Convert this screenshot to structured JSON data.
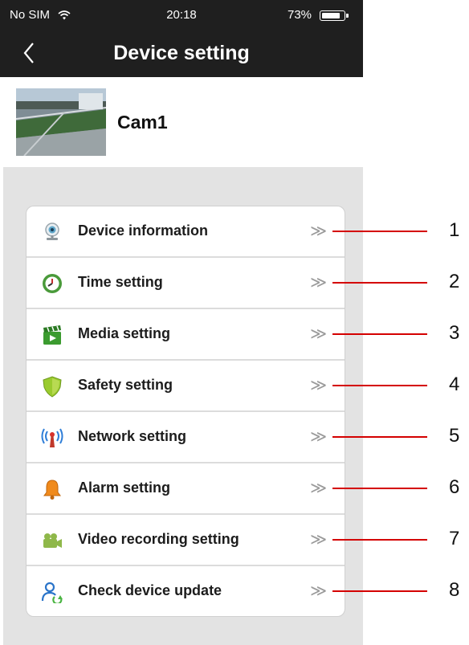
{
  "status_bar": {
    "carrier": "No SIM",
    "time": "20:18",
    "battery": "73%",
    "battery_level": 0.73,
    "wifi_icon": "wifi-icon"
  },
  "nav": {
    "title": "Device setting",
    "back_icon": "chevron-left-icon"
  },
  "device": {
    "name": "Cam1",
    "thumbnail": "camera-snapshot"
  },
  "menu": {
    "arrow": "≫",
    "items": [
      {
        "label": "Device information",
        "icon": "webcam-icon",
        "callout": "1"
      },
      {
        "label": "Time setting",
        "icon": "clock-icon",
        "callout": "2"
      },
      {
        "label": "Media setting",
        "icon": "clapperboard-icon",
        "callout": "3"
      },
      {
        "label": "Safety setting",
        "icon": "shield-icon",
        "callout": "4"
      },
      {
        "label": "Network setting",
        "icon": "antenna-icon",
        "callout": "5"
      },
      {
        "label": "Alarm setting",
        "icon": "bell-icon",
        "callout": "6"
      },
      {
        "label": "Video recording setting",
        "icon": "video-camera-icon",
        "callout": "7"
      },
      {
        "label": "Check device update",
        "icon": "user-update-icon",
        "callout": "8"
      }
    ]
  },
  "colors": {
    "bar": "#1f1f1f",
    "panel": "#e3e3e3",
    "callout_line": "#d40000"
  }
}
